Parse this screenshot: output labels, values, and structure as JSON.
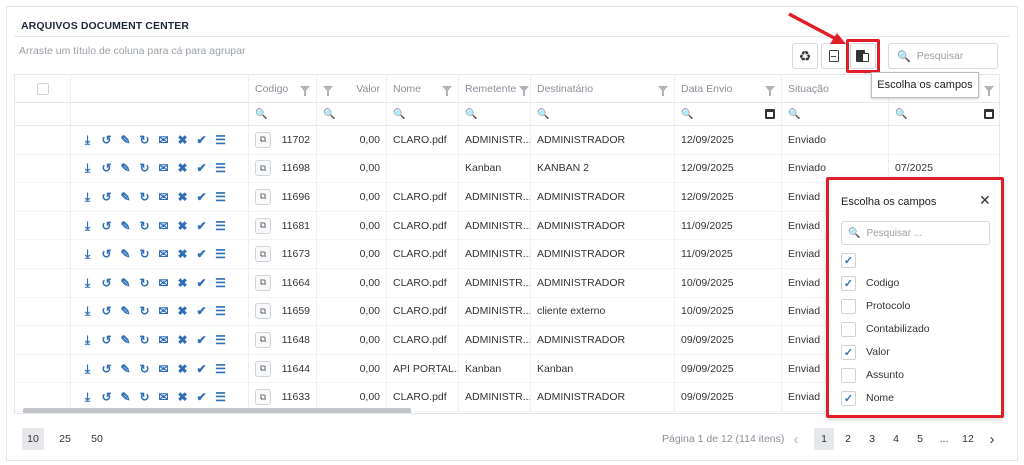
{
  "panel": {
    "title": "ARQUIVOS DOCUMENT CENTER"
  },
  "toolbar": {
    "group_hint": "Arraste um título de coluna para cá para agrupar",
    "search_placeholder": "Pesquisar",
    "tooltip": "Escolha os campos"
  },
  "columns": [
    {
      "key": "select",
      "label": ""
    },
    {
      "key": "actions",
      "label": ""
    },
    {
      "key": "codigo",
      "label": "Codigo"
    },
    {
      "key": "valor",
      "label": "Valor"
    },
    {
      "key": "nome",
      "label": "Nome"
    },
    {
      "key": "remetente",
      "label": "Remetente"
    },
    {
      "key": "destinatario",
      "label": "Destinatário"
    },
    {
      "key": "data_envio",
      "label": "Data Envio"
    },
    {
      "key": "situacao",
      "label": "Situação"
    },
    {
      "key": "extra",
      "label": ""
    }
  ],
  "rows": [
    {
      "codigo": "11702",
      "valor": "0,00",
      "nome": "CLARO.pdf",
      "remetente": "ADMINISTR...",
      "destinatario": "ADMINISTRADOR",
      "data_envio": "12/09/2025",
      "situacao": "Enviado",
      "extra": ""
    },
    {
      "codigo": "11698",
      "valor": "0,00",
      "nome": "",
      "remetente": "Kanban",
      "destinatario": "KANBAN 2",
      "data_envio": "12/09/2025",
      "situacao": "Enviado",
      "extra": "07/2025"
    },
    {
      "codigo": "11696",
      "valor": "0,00",
      "nome": "CLARO.pdf",
      "remetente": "ADMINISTR...",
      "destinatario": "ADMINISTRADOR",
      "data_envio": "12/09/2025",
      "situacao": "Enviad",
      "extra": ""
    },
    {
      "codigo": "11681",
      "valor": "0,00",
      "nome": "CLARO.pdf",
      "remetente": "ADMINISTR...",
      "destinatario": "ADMINISTRADOR",
      "data_envio": "11/09/2025",
      "situacao": "Enviad",
      "extra": ""
    },
    {
      "codigo": "11673",
      "valor": "0,00",
      "nome": "CLARO.pdf",
      "remetente": "ADMINISTR...",
      "destinatario": "ADMINISTRADOR",
      "data_envio": "11/09/2025",
      "situacao": "Enviad",
      "extra": ""
    },
    {
      "codigo": "11664",
      "valor": "0,00",
      "nome": "CLARO.pdf",
      "remetente": "ADMINISTR...",
      "destinatario": "ADMINISTRADOR",
      "data_envio": "10/09/2025",
      "situacao": "Enviad",
      "extra": ""
    },
    {
      "codigo": "11659",
      "valor": "0,00",
      "nome": "CLARO.pdf",
      "remetente": "ADMINISTR...",
      "destinatario": "cliente externo",
      "data_envio": "10/09/2025",
      "situacao": "Enviad",
      "extra": ""
    },
    {
      "codigo": "11648",
      "valor": "0,00",
      "nome": "CLARO.pdf",
      "remetente": "ADMINISTR...",
      "destinatario": "ADMINISTRADOR",
      "data_envio": "09/09/2025",
      "situacao": "Enviad",
      "extra": ""
    },
    {
      "codigo": "11644",
      "valor": "0,00",
      "nome": "API PORTAL...",
      "remetente": "Kanban",
      "destinatario": "Kanban",
      "data_envio": "09/09/2025",
      "situacao": "Enviad",
      "extra": ""
    },
    {
      "codigo": "11633",
      "valor": "0,00",
      "nome": "CLARO.pdf",
      "remetente": "ADMINISTR...",
      "destinatario": "ADMINISTRADOR",
      "data_envio": "09/09/2025",
      "situacao": "Enviad",
      "extra": ""
    }
  ],
  "row_actions": [
    "download-icon",
    "history-icon",
    "edit-icon",
    "refresh-icon",
    "envelope-open-icon",
    "cancel-icon",
    "approve-icon",
    "details-icon"
  ],
  "pager": {
    "sizes": [
      "10",
      "25",
      "50"
    ],
    "active_size": "10",
    "info": "Página 1 de 12 (114 itens)",
    "pages": [
      "1",
      "2",
      "3",
      "4",
      "5",
      "...",
      "12"
    ],
    "active_page": "1"
  },
  "chooser": {
    "title": "Escolha os campos",
    "search_placeholder": "Pesquisar ...",
    "options": [
      {
        "label": "",
        "checked": true
      },
      {
        "label": "Codigo",
        "checked": true
      },
      {
        "label": "Protocolo",
        "checked": false
      },
      {
        "label": "Contabilizado",
        "checked": false
      },
      {
        "label": "Valor",
        "checked": true
      },
      {
        "label": "Assunto",
        "checked": false
      },
      {
        "label": "Nome",
        "checked": true
      }
    ]
  },
  "colors": {
    "accent": "#2e6fb8",
    "highlight": "#e11d2a"
  }
}
